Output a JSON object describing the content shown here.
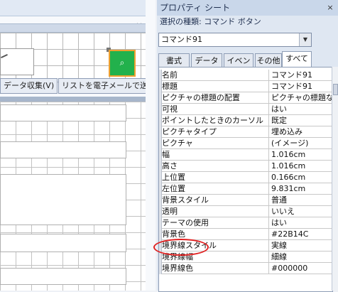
{
  "left_panel": {
    "close_glyph": "×",
    "buttons": [
      "データ収集(V)",
      "リストを電子メールで送"
    ],
    "command_button_color": "#22B14C",
    "command_button_icon": "binoculars-icon"
  },
  "property_sheet": {
    "title": "プロパティ シート",
    "close_glyph": "×",
    "selection_label": "選択の種類:",
    "selection_type": "コマンド ボタン",
    "selected_object": "コマンド91",
    "tabs": [
      "書式",
      "データ",
      "イベント",
      "その他",
      "すべて"
    ],
    "active_tab": "すべて",
    "properties": [
      {
        "name": "名前",
        "value": "コマンド91"
      },
      {
        "name": "標題",
        "value": "コマンド91"
      },
      {
        "name": "ピクチャの標題の配置",
        "value": "ピクチャの標題なし"
      },
      {
        "name": "可視",
        "value": "はい"
      },
      {
        "name": "ポイントしたときのカーソル",
        "value": "既定"
      },
      {
        "name": "ピクチャタイプ",
        "value": "埋め込み"
      },
      {
        "name": "ピクチャ",
        "value": "(イメージ)"
      },
      {
        "name": "幅",
        "value": "1.016cm"
      },
      {
        "name": "高さ",
        "value": "1.016cm"
      },
      {
        "name": "上位置",
        "value": "0.166cm"
      },
      {
        "name": "左位置",
        "value": "9.831cm"
      },
      {
        "name": "背景スタイル",
        "value": "普通"
      },
      {
        "name": "透明",
        "value": "いいえ"
      },
      {
        "name": "テーマの使用",
        "value": "はい"
      },
      {
        "name": "背景色",
        "value": "#22B14C"
      },
      {
        "name": "境界線スタイル",
        "value": "実線"
      },
      {
        "name": "境界線幅",
        "value": "細線"
      },
      {
        "name": "境界線色",
        "value": "#000000"
      }
    ],
    "highlight_color": "#E02020"
  }
}
